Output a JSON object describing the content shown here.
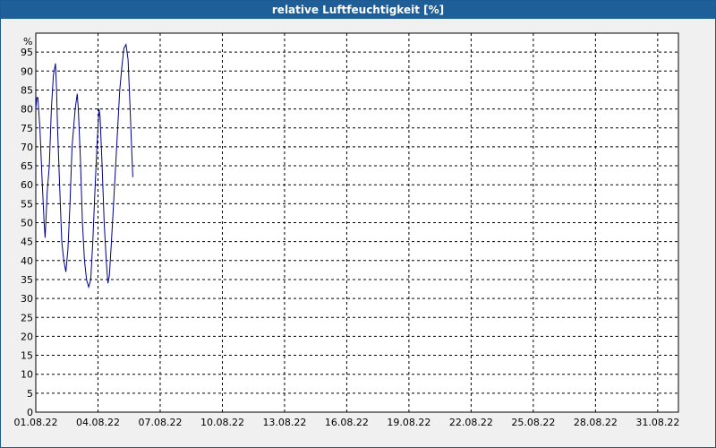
{
  "window": {
    "title": "relative Luftfeuchtigkeit [%]"
  },
  "colors": {
    "titlebar": "#1f5f99",
    "series": "#00008b",
    "grid": "#000000",
    "background": "#f0f0f0"
  },
  "chart_data": {
    "type": "line",
    "title": "relative Luftfeuchtigkeit [%]",
    "ylabel": "%",
    "xlabel": "",
    "ylim": [
      0,
      100
    ],
    "y_ticks": [
      0,
      5,
      10,
      15,
      20,
      25,
      30,
      35,
      40,
      45,
      50,
      55,
      60,
      65,
      70,
      75,
      80,
      85,
      90,
      95
    ],
    "x_range_days": [
      0,
      31
    ],
    "x_ticks": [
      {
        "label": "01.08.22",
        "day": 0
      },
      {
        "label": "04.08.22",
        "day": 3
      },
      {
        "label": "07.08.22",
        "day": 6
      },
      {
        "label": "10.08.22",
        "day": 9
      },
      {
        "label": "13.08.22",
        "day": 12
      },
      {
        "label": "16.08.22",
        "day": 15
      },
      {
        "label": "19.08.22",
        "day": 18
      },
      {
        "label": "22.08.22",
        "day": 21
      },
      {
        "label": "25.08.22",
        "day": 24
      },
      {
        "label": "28.08.22",
        "day": 27
      },
      {
        "label": "31.08.22",
        "day": 30
      }
    ],
    "grid": true,
    "series": [
      {
        "color": "#00008b",
        "points": [
          [
            0.0,
            80
          ],
          [
            0.05,
            83
          ],
          [
            0.1,
            83
          ],
          [
            0.2,
            75
          ],
          [
            0.3,
            62
          ],
          [
            0.4,
            50
          ],
          [
            0.45,
            46
          ],
          [
            0.5,
            52
          ],
          [
            0.55,
            58
          ],
          [
            0.65,
            65
          ],
          [
            0.75,
            80
          ],
          [
            0.85,
            89
          ],
          [
            0.95,
            92
          ],
          [
            1.0,
            85
          ],
          [
            1.05,
            75
          ],
          [
            1.15,
            60
          ],
          [
            1.25,
            45
          ],
          [
            1.35,
            40
          ],
          [
            1.45,
            37
          ],
          [
            1.55,
            43
          ],
          [
            1.65,
            55
          ],
          [
            1.75,
            70
          ],
          [
            1.9,
            80
          ],
          [
            2.0,
            84
          ],
          [
            2.05,
            80
          ],
          [
            2.15,
            67
          ],
          [
            2.25,
            50
          ],
          [
            2.35,
            40
          ],
          [
            2.45,
            35
          ],
          [
            2.55,
            33
          ],
          [
            2.65,
            35
          ],
          [
            2.75,
            45
          ],
          [
            2.85,
            58
          ],
          [
            2.95,
            70
          ],
          [
            3.05,
            80
          ],
          [
            3.1,
            78
          ],
          [
            3.2,
            65
          ],
          [
            3.3,
            50
          ],
          [
            3.4,
            40
          ],
          [
            3.48,
            34
          ],
          [
            3.55,
            36
          ],
          [
            3.65,
            45
          ],
          [
            3.75,
            55
          ],
          [
            3.85,
            65
          ],
          [
            3.95,
            75
          ],
          [
            4.05,
            85
          ],
          [
            4.15,
            91
          ],
          [
            4.25,
            96
          ],
          [
            4.35,
            97
          ],
          [
            4.45,
            93
          ],
          [
            4.55,
            80
          ],
          [
            4.62,
            70
          ],
          [
            4.68,
            62
          ]
        ]
      }
    ]
  }
}
